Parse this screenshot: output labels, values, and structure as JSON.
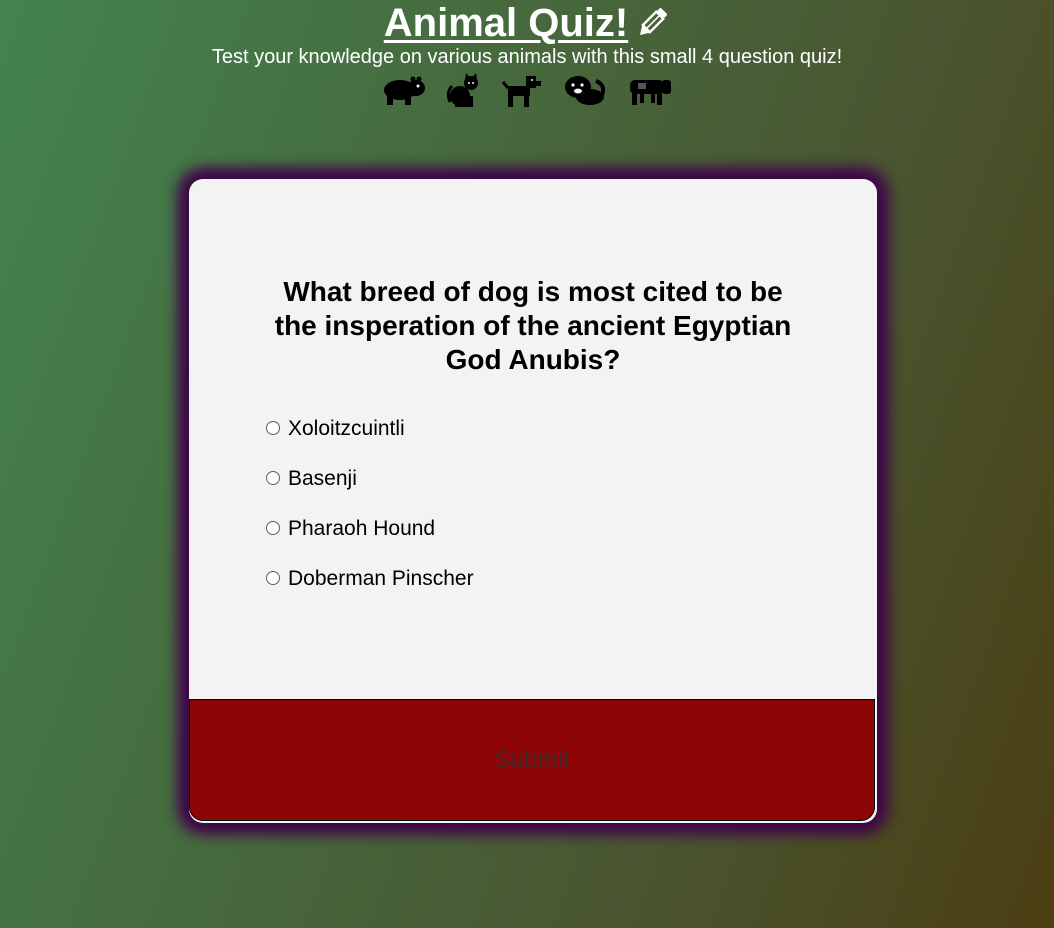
{
  "header": {
    "title": "Animal Quiz!",
    "subtitle": "Test your knowledge on various animals with this small 4 question quiz!",
    "title_icon": "pencil-icon",
    "animal_icons": [
      "hippo-icon",
      "cat-icon",
      "dog-icon",
      "otter-icon",
      "cow-icon"
    ]
  },
  "quiz": {
    "question": "What breed of dog is most cited to be the insperation of the ancient Egyptian God Anubis?",
    "options": [
      "Xoloitzcuintli",
      "Basenji",
      "Pharaoh Hound",
      "Doberman Pinscher"
    ],
    "submit_label": "Submit"
  },
  "colors": {
    "card_background": "#f3f3f3",
    "card_glow": "#3b0744",
    "submit_background": "#8e0505",
    "header_text": "#ffffff"
  }
}
